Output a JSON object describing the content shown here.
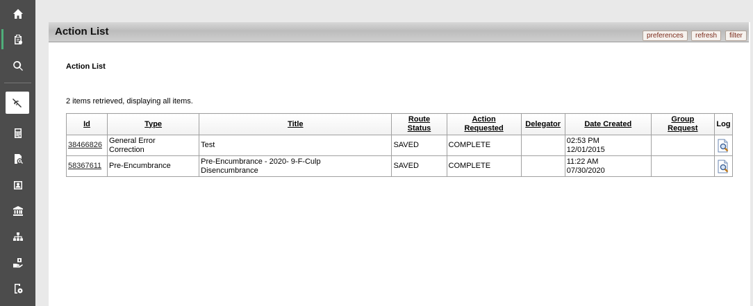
{
  "sidebar": {
    "items": [
      {
        "icon": "home-icon"
      },
      {
        "icon": "clipboard-check-icon"
      },
      {
        "icon": "search-icon"
      },
      {
        "icon": "no-signal-icon"
      },
      {
        "icon": "calculator-icon"
      },
      {
        "icon": "document-search-icon"
      },
      {
        "icon": "user-card-icon"
      },
      {
        "icon": "bank-icon"
      },
      {
        "icon": "org-chart-icon"
      },
      {
        "icon": "money-hand-icon"
      },
      {
        "icon": "money-settings-icon"
      }
    ]
  },
  "header": {
    "title": "Action List",
    "buttons": {
      "preferences": "preferences",
      "refresh": "refresh",
      "filter": "filter"
    }
  },
  "main": {
    "section_heading": "Action List",
    "items_text": "2 items retrieved, displaying all items."
  },
  "table": {
    "headers": {
      "id": "Id",
      "type": "Type",
      "title": "Title",
      "route_status_1": "Route",
      "route_status_2": "Status",
      "action_requested_1": "Action",
      "action_requested_2": "Requested",
      "delegator": "Delegator",
      "date_created": "Date Created",
      "group_request_1": "Group",
      "group_request_2": "Request",
      "log": "Log"
    },
    "rows": [
      {
        "id": "38466826",
        "type_1": "General Error",
        "type_2": "Correction",
        "title_1": "Test",
        "title_2": "",
        "route_status": "SAVED",
        "action_requested": "COMPLETE",
        "delegator": "",
        "time": "02:53 PM",
        "date": "12/01/2015",
        "group_request": ""
      },
      {
        "id": "58367611",
        "type_1": "Pre-Encumbrance",
        "type_2": "",
        "title_1": "Pre-Encumbrance - 2020- 9-F-Culp",
        "title_2": "Disencumbrance",
        "route_status": "SAVED",
        "action_requested": "COMPLETE",
        "delegator": "",
        "time": "11:22 AM",
        "date": "07/30/2020",
        "group_request": ""
      }
    ]
  },
  "colors": {
    "sidebar_bg": "#4c4c4c",
    "active_indicator": "#4fae7a",
    "button_text": "#7a2a1a"
  }
}
